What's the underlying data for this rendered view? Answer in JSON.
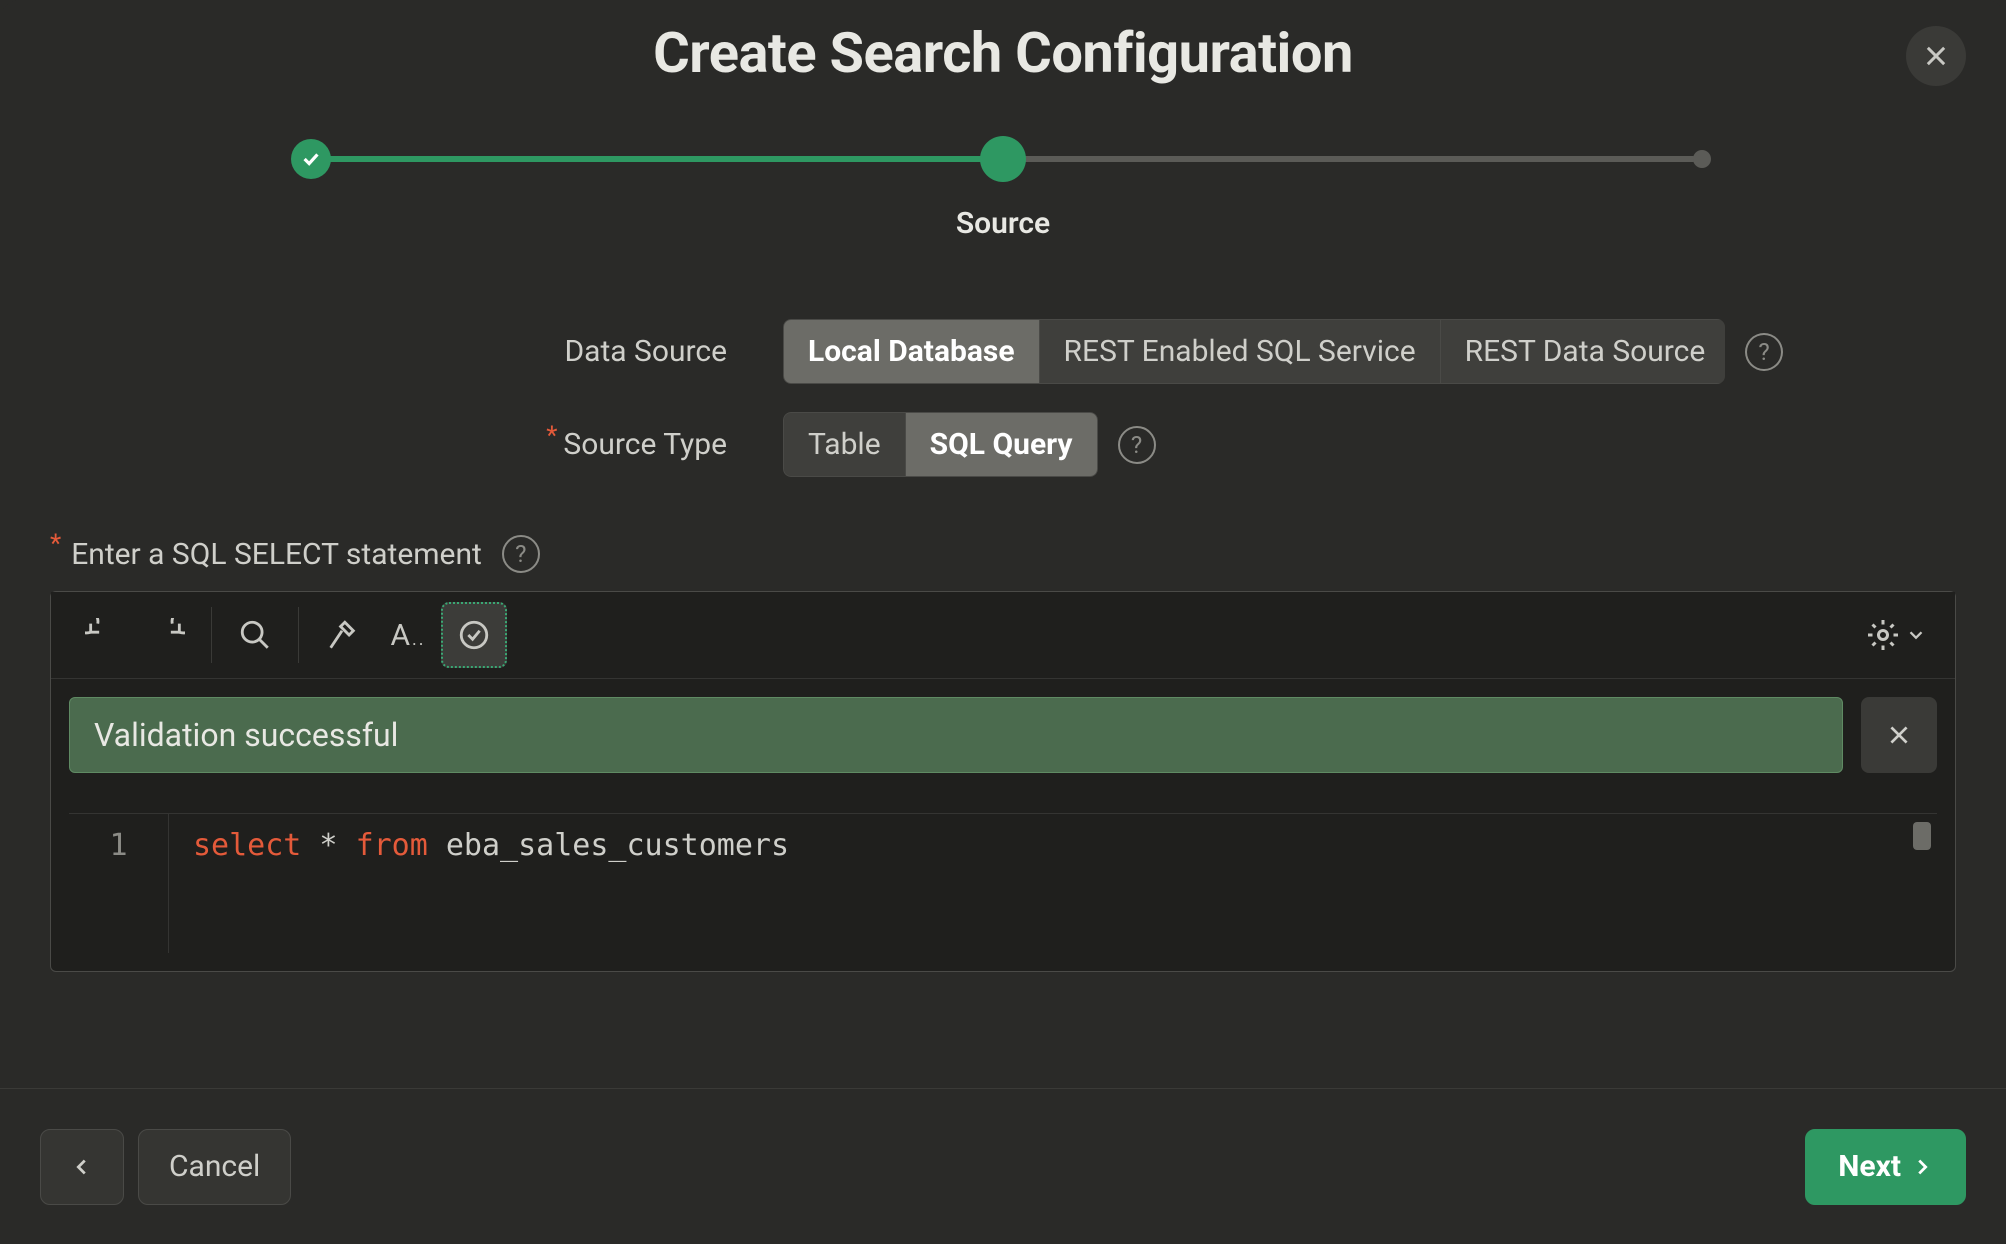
{
  "header": {
    "title": "Create Search Configuration"
  },
  "stepper": {
    "current_label": "Source"
  },
  "form": {
    "data_source": {
      "label": "Data Source",
      "options": [
        "Local Database",
        "REST Enabled SQL Service",
        "REST Data Source"
      ],
      "selected": "Local Database"
    },
    "source_type": {
      "label": "Source Type",
      "required": true,
      "options": [
        "Table",
        "SQL Query"
      ],
      "selected": "SQL Query"
    },
    "sql_label": "Enter a SQL SELECT statement"
  },
  "editor": {
    "validation_message": "Validation successful",
    "line_number": "1",
    "code_kw1": "select",
    "code_mid": " * ",
    "code_kw2": "from",
    "code_rest": " eba_sales_customers"
  },
  "footer": {
    "cancel": "Cancel",
    "next": "Next"
  },
  "help_glyph": "?"
}
